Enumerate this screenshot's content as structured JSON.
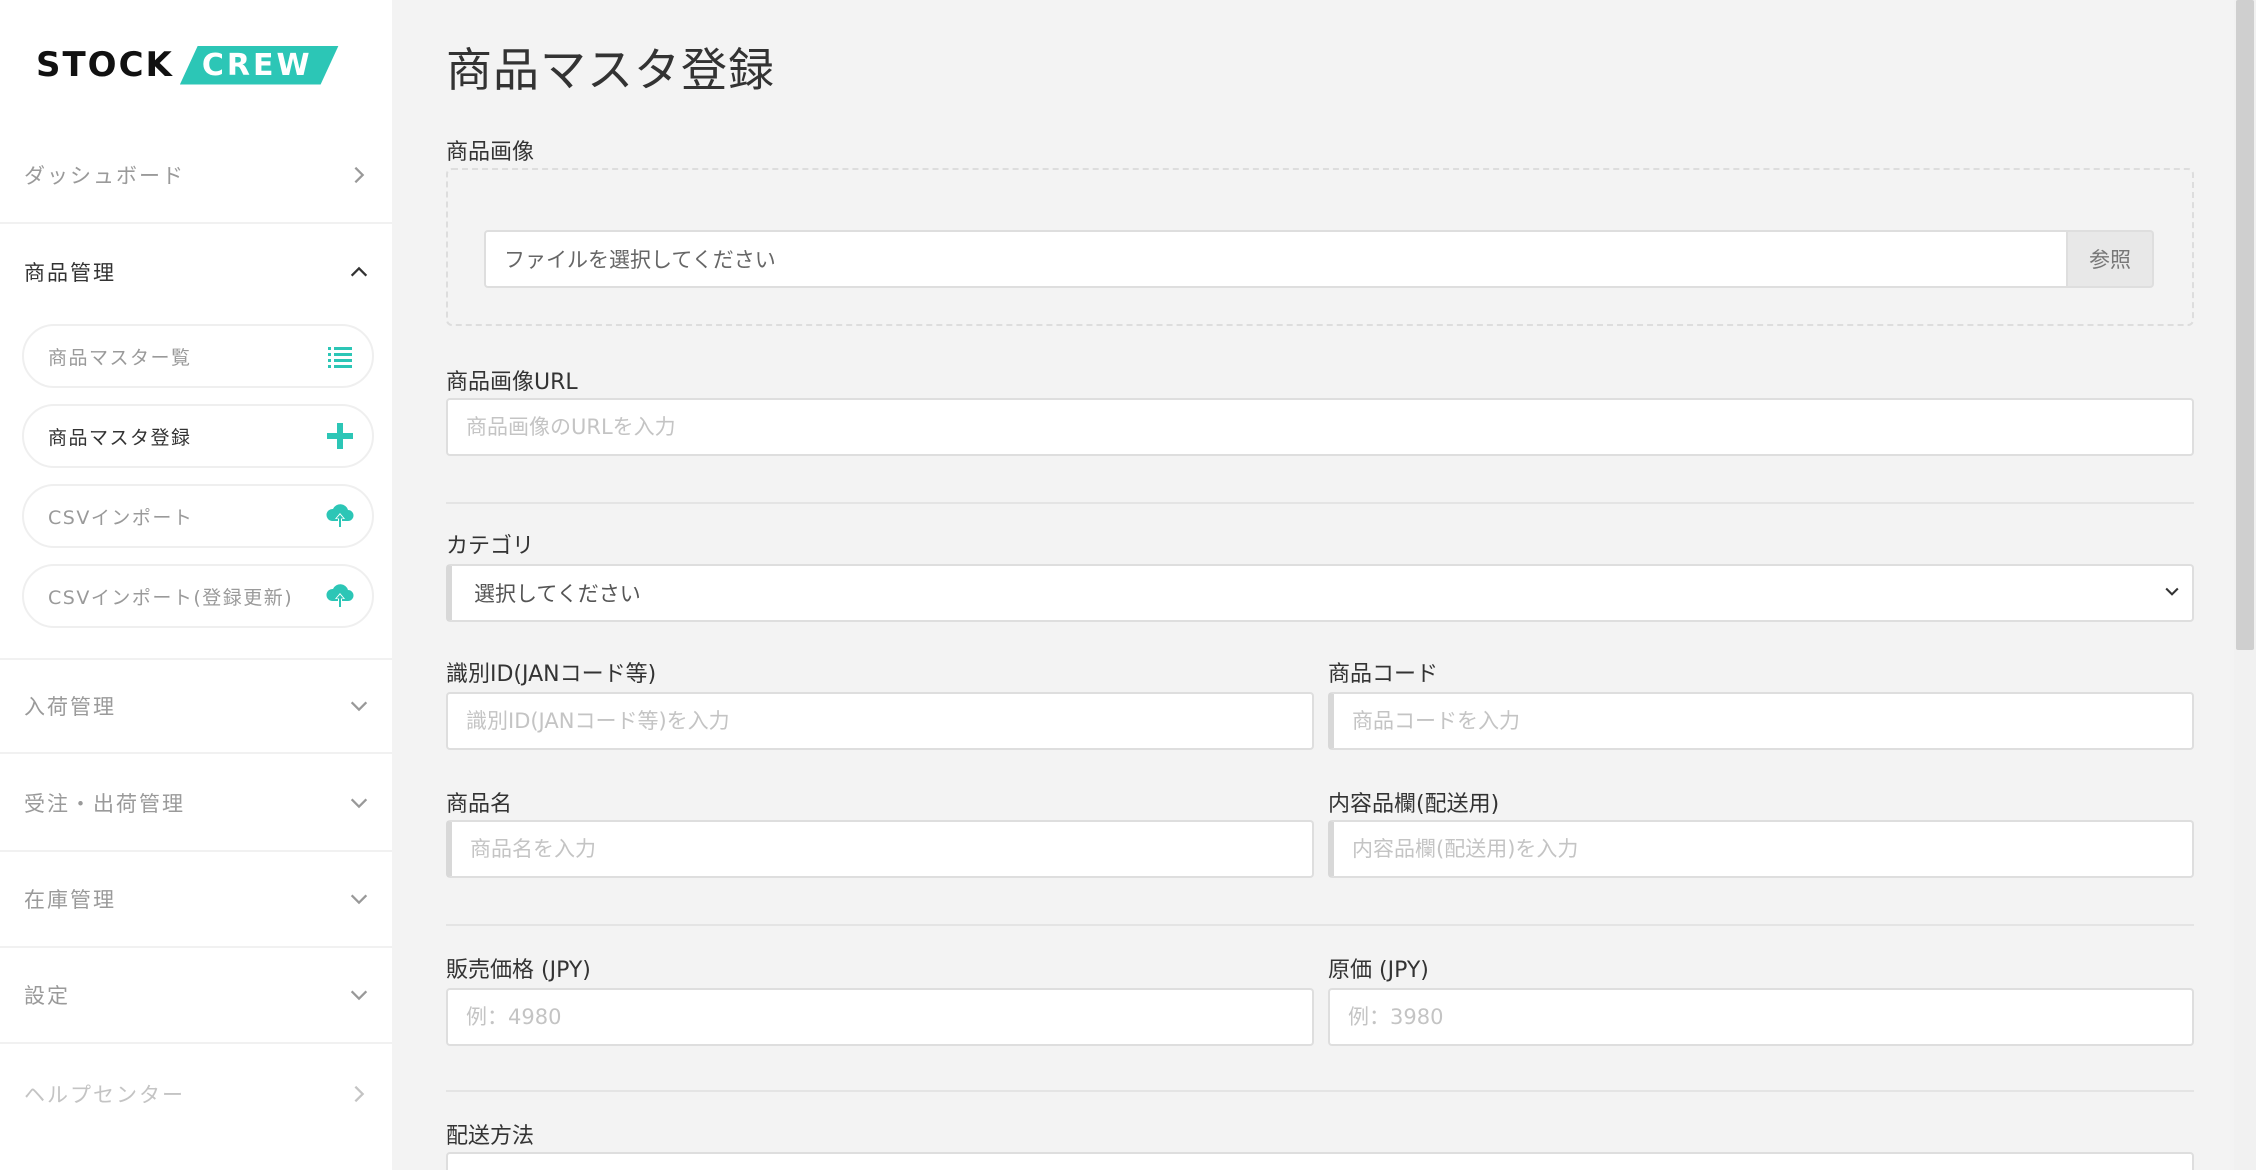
{
  "logo": {
    "left": "STOCK",
    "right": "CREW"
  },
  "sidebar": {
    "dashboard": "ダッシュボード",
    "product_mgmt": "商品管理",
    "sub_items": [
      {
        "label": "商品マスター覧",
        "icon": "list-icon"
      },
      {
        "label": "商品マスタ登録",
        "icon": "plus-icon"
      },
      {
        "label": "CSVインポート",
        "icon": "cloud-upload-icon"
      },
      {
        "label": "CSVインポート(登録更新)",
        "icon": "cloud-upload-icon"
      }
    ],
    "inbound": "入荷管理",
    "orders": "受注・出荷管理",
    "inventory": "在庫管理",
    "settings": "設定",
    "help": "ヘルプセンター"
  },
  "page": {
    "title": "商品マスタ登録",
    "image_label": "商品画像",
    "file_placeholder": "ファイルを選択してください",
    "browse_button": "参照",
    "image_url_label": "商品画像URL",
    "image_url_placeholder": "商品画像のURLを入力",
    "category_label": "カテゴリ",
    "category_value": "選択してください",
    "id_label": "識別ID(JANコード等)",
    "id_placeholder": "識別ID(JANコード等)を入力",
    "code_label": "商品コード",
    "code_placeholder": "商品コードを入力",
    "name_label": "商品名",
    "name_placeholder": "商品名を入力",
    "content_label": "内容品欄(配送用)",
    "content_placeholder": "内容品欄(配送用)を入力",
    "price_label": "販売価格 (JPY)",
    "price_placeholder": "例：4980",
    "cost_label": "原価 (JPY)",
    "cost_placeholder": "例：3980",
    "shipping_label": "配送方法"
  },
  "colors": {
    "accent": "#2cc6b6",
    "sidebar_bg": "#ffffff",
    "main_bg": "#f3f3f3"
  }
}
